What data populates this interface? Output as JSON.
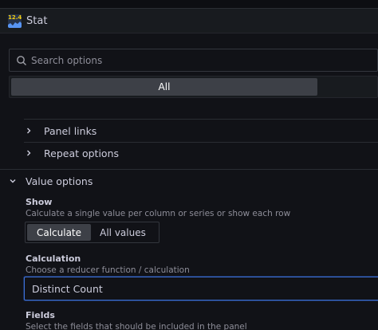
{
  "panel": {
    "viz_name": "Stat",
    "icon_text": "12.4"
  },
  "search": {
    "placeholder": "Search options"
  },
  "filter": {
    "selected": "All"
  },
  "collapsed_sections": [
    {
      "label": "Panel links"
    },
    {
      "label": "Repeat options"
    }
  ],
  "value_options": {
    "title": "Value options",
    "show": {
      "label": "Show",
      "description": "Calculate a single value per column or series or show each row",
      "options": [
        "Calculate",
        "All values"
      ],
      "selected": "Calculate"
    },
    "calculation": {
      "label": "Calculation",
      "description": "Choose a reducer function / calculation",
      "value": "Distinct Count"
    },
    "fields": {
      "label": "Fields",
      "description": "Select the fields that should be included in the panel"
    }
  },
  "colors": {
    "focus_border": "#3d71d9",
    "accent": "#f2cc0c"
  }
}
